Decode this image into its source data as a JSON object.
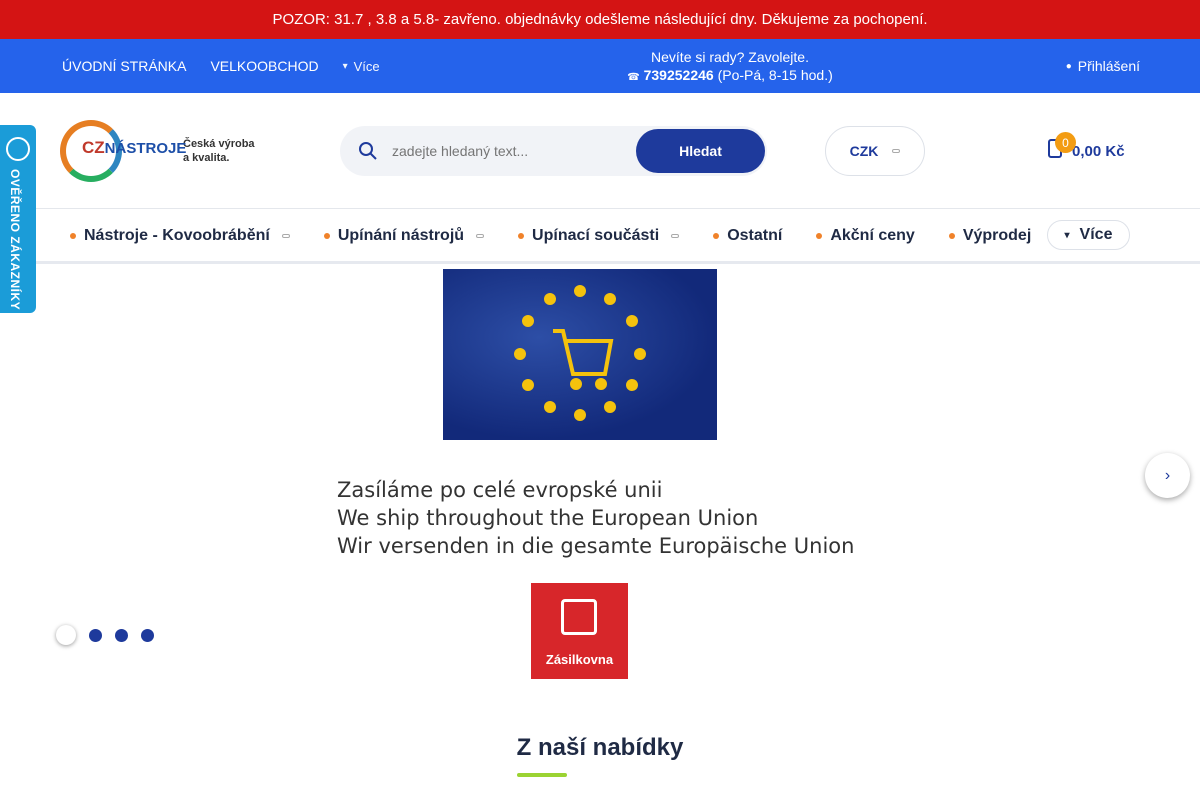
{
  "notice": {
    "text": "POZOR: 31.7 , 3.8 a 5.8- zavřeno. objednávky odešleme následující dny. Děkujeme za pochopení."
  },
  "topnav": {
    "items": [
      "ÚVODNÍ STRÁNKA",
      "VELKOOBCHOD"
    ],
    "more_label": "Více",
    "help_line1": "Nevíte si rady? Zavolejte.",
    "phone": "739252246",
    "hours": "(Po-Pá, 8-15 hod.)",
    "login": "Přihlášení"
  },
  "logo": {
    "brand_cz": "CZ",
    "brand_name": "NÁSTROJE",
    "tagline1": "Česká výroba",
    "tagline2": "a kvalita."
  },
  "search": {
    "placeholder": "zadejte hledaný text...",
    "button": "Hledat"
  },
  "currency": {
    "value": "CZK"
  },
  "cart": {
    "count": "0",
    "total": "0,00 Kč"
  },
  "categories": [
    "Nástroje - Kovoobrábění",
    "Upínání nástrojů",
    "Upínací součásti",
    "Ostatní",
    "Akční ceny",
    "Výprodej"
  ],
  "category_more": "Více",
  "side_badge": {
    "text": "OVĚŘENO ZÁKAZNÍKY"
  },
  "slide": {
    "line1": "Zasíláme po celé evropské unii",
    "line2": "We ship throughout the European Union",
    "line3": "Wir versenden in die gesamte Europäische Union",
    "carrier": "Zásilkovna"
  },
  "section": {
    "title": "Z naší nabídky"
  },
  "colors": {
    "notice": "#d41414",
    "topbar": "#2563eb",
    "primary": "#1e3a9c",
    "accent": "#f0822a",
    "badge": "#1b9cd8"
  }
}
